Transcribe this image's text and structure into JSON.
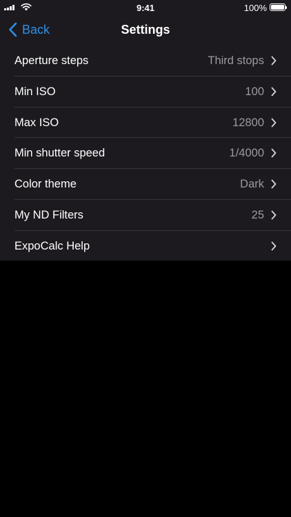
{
  "status_bar": {
    "time": "9:41",
    "battery_percent": "100%"
  },
  "nav": {
    "back_label": "Back",
    "title": "Settings"
  },
  "settings": [
    {
      "label": "Aperture steps",
      "value": "Third stops"
    },
    {
      "label": "Min ISO",
      "value": "100"
    },
    {
      "label": "Max ISO",
      "value": "12800"
    },
    {
      "label": "Min shutter speed",
      "value": "1/4000"
    },
    {
      "label": "Color theme",
      "value": "Dark"
    },
    {
      "label": "My ND Filters",
      "value": "25"
    },
    {
      "label": "ExpoCalc Help",
      "value": ""
    }
  ],
  "colors": {
    "accent": "#2f8fe6",
    "background": "#1c1a1f",
    "secondary_text": "#9c9aa1",
    "separator": "#39373d"
  },
  "icons": [
    "cellular-signal-icon",
    "wifi-icon",
    "battery-icon",
    "chevron-left-icon",
    "chevron-right-icon"
  ]
}
